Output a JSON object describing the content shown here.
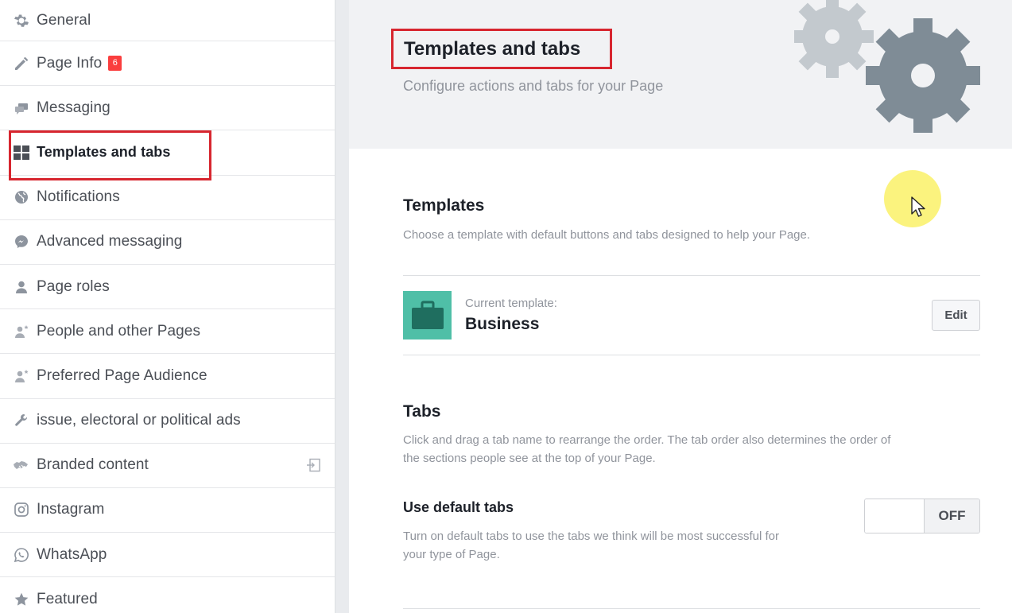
{
  "sidebar": {
    "items": [
      {
        "label": "General",
        "icon": "gear-icon"
      },
      {
        "label": "Page Info",
        "icon": "pencil-icon",
        "badge": "6"
      },
      {
        "label": "Messaging",
        "icon": "chat-icon"
      },
      {
        "label": "Templates and tabs",
        "icon": "grid-icon",
        "active": true
      },
      {
        "label": "Notifications",
        "icon": "globe-icon"
      },
      {
        "label": "Advanced messaging",
        "icon": "messenger-icon"
      },
      {
        "label": "Page roles",
        "icon": "person-icon"
      },
      {
        "label": "People and other Pages",
        "icon": "person-star-icon"
      },
      {
        "label": "Preferred Page Audience",
        "icon": "person-star-icon"
      },
      {
        "label": "issue, electoral or political ads",
        "icon": "wrench-icon"
      },
      {
        "label": "Branded content",
        "icon": "handshake-icon",
        "trailing_icon": "export-icon"
      },
      {
        "label": "Instagram",
        "icon": "instagram-icon"
      },
      {
        "label": "WhatsApp",
        "icon": "whatsapp-icon"
      },
      {
        "label": "Featured",
        "icon": "star-icon"
      }
    ]
  },
  "header": {
    "title": "Templates and tabs",
    "subtitle": "Configure actions and tabs for your Page"
  },
  "templates": {
    "title": "Templates",
    "description": "Choose a template with default buttons and tabs designed to help your Page.",
    "current_label": "Current template:",
    "current_value": "Business",
    "edit_label": "Edit"
  },
  "tabs": {
    "title": "Tabs",
    "description_line1": "Click and drag a tab name to rearrange the order. The tab order also determines the order of",
    "description_line2": "the sections people see at the top of your Page.",
    "default_tabs_title": "Use default tabs",
    "default_tabs_desc_line1": "Turn on default tabs to use the tabs we think will be most successful for",
    "default_tabs_desc_line2": "your type of Page.",
    "toggle_state": "OFF"
  },
  "colors": {
    "highlight": "#d7262f",
    "badge": "#fa3e3e",
    "template_thumb": "#4fbfa7",
    "gear": "#7f8c96"
  }
}
